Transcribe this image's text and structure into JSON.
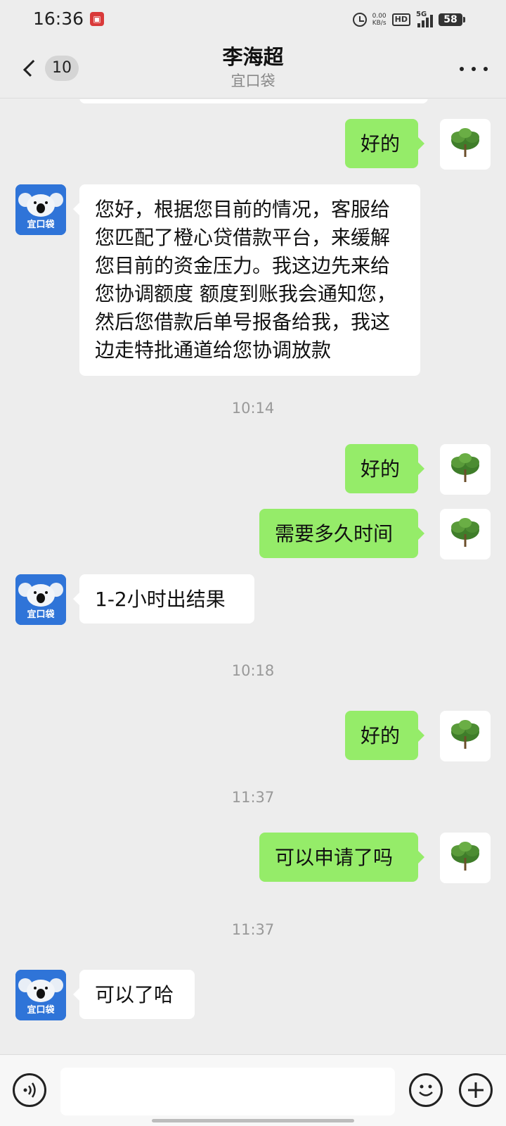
{
  "status_bar": {
    "time": "16:36",
    "net_speed_value": "0.00",
    "net_speed_unit": "KB/s",
    "hd": "HD",
    "network": "5G",
    "battery": "58"
  },
  "header": {
    "back_count": "10",
    "title": "李海超",
    "subtitle": "宜口袋"
  },
  "avatar_left": {
    "label": "宜口袋",
    "bg_color": "#2f74d8"
  },
  "messages": {
    "m1": "好的",
    "m2": "您好，根据您目前的情况，客服给您匹配了橙心贷借款平台，来缓解您目前的资金压力。我这边先来给您协调额度 额度到账我会通知您，然后您借款后单号报备给我，我这边走特批通道给您协调放款",
    "t1": "10:14",
    "m3": "好的",
    "m4": "需要多久时间",
    "m5": "1-2小时出结果",
    "t2": "10:18",
    "m6": "好的",
    "t3": "11:37",
    "m7": "可以申请了吗",
    "t4": "11:37",
    "m8": "可以了哈"
  },
  "input": {
    "placeholder": ""
  },
  "colors": {
    "sent_bubble": "#95ec69",
    "received_bubble": "#ffffff",
    "background": "#ededed"
  }
}
